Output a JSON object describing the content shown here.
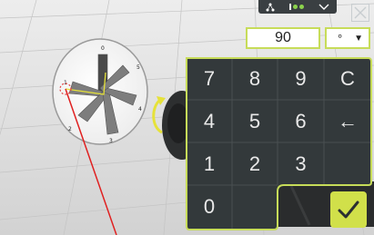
{
  "input": {
    "value": "90"
  },
  "unit": {
    "selected": "°",
    "caret": "▼"
  },
  "keypad": {
    "k7": "7",
    "k8": "8",
    "k9": "9",
    "clear": "C",
    "k4": "4",
    "k5": "5",
    "k6": "6",
    "backspace": "←",
    "k1": "1",
    "k2": "2",
    "k3": "3",
    "k0": "0"
  },
  "dial": {
    "labels": [
      "0",
      "1",
      "2",
      "3",
      "4",
      "5"
    ]
  },
  "icons": {
    "status": [
      "network-icon",
      "signal-dots-icon",
      "chevron-down-icon"
    ],
    "close": "close-icon",
    "confirm": "checkmark-icon"
  },
  "colors": {
    "accent": "#c7dc59",
    "panel": "#33393b",
    "confirm": "#d1e04a"
  }
}
